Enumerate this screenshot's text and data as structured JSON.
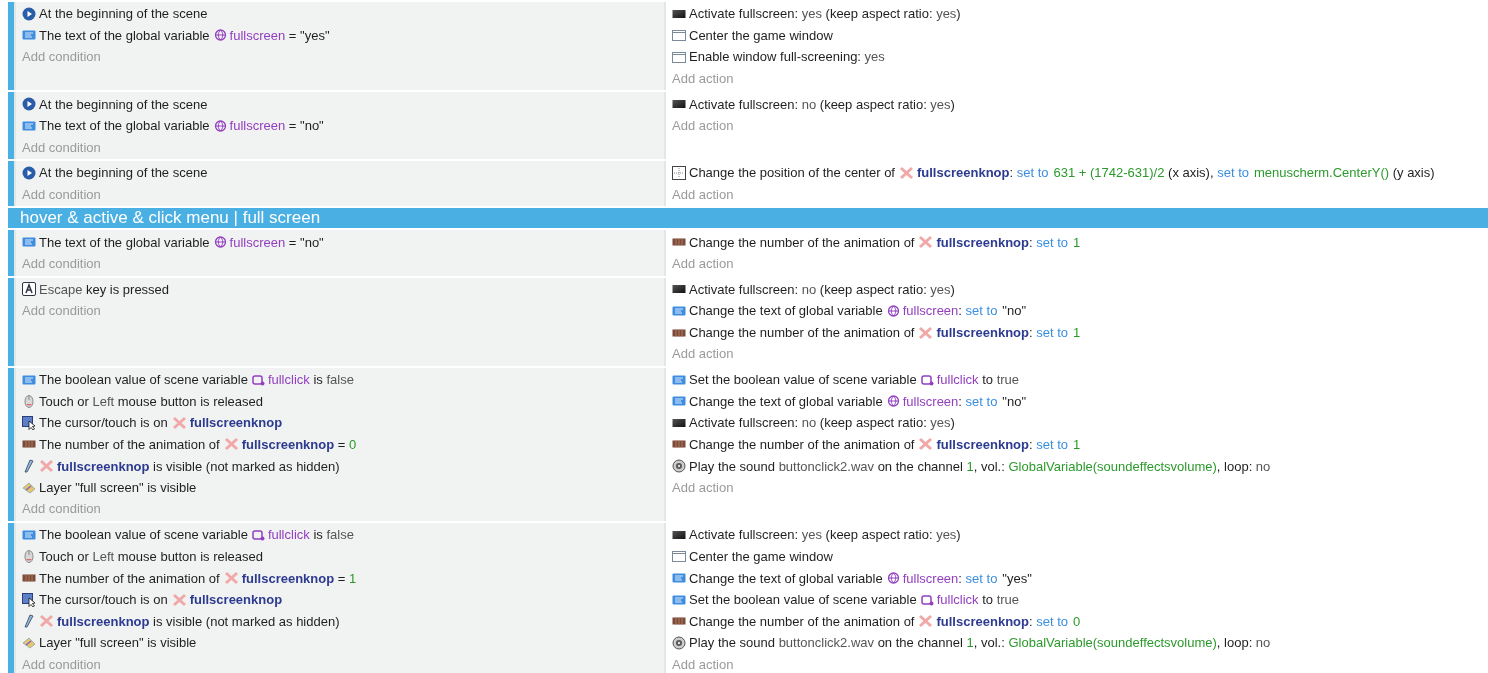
{
  "events": [
    {
      "kind": "event",
      "conditions": [
        {
          "kind": "start",
          "parts": [
            {
              "kind": "t",
              "text": "At the beginning of the scene"
            }
          ]
        },
        {
          "kind": "var",
          "parts": [
            {
              "kind": "t",
              "text": "The text of the global variable"
            },
            {
              "kind": "gv",
              "text": "fullscreen"
            },
            {
              "kind": "t",
              "text": " = "
            },
            {
              "kind": "t",
              "text": "\"yes\""
            }
          ]
        }
      ],
      "add_condition": "Add condition",
      "actions": [
        {
          "kind": "fullscreen",
          "parts": [
            {
              "kind": "t",
              "text": "Activate fullscreen: "
            },
            {
              "kind": "p",
              "text": "yes"
            },
            {
              "kind": "t",
              "text": " (keep aspect ratio: "
            },
            {
              "kind": "p",
              "text": "yes"
            },
            {
              "kind": "t",
              "text": ")"
            }
          ]
        },
        {
          "kind": "window",
          "parts": [
            {
              "kind": "t",
              "text": "Center the game window"
            }
          ]
        },
        {
          "kind": "window",
          "parts": [
            {
              "kind": "t",
              "text": "Enable window full-screening: "
            },
            {
              "kind": "p",
              "text": "yes"
            }
          ]
        }
      ],
      "add_action": "Add action"
    },
    {
      "kind": "event",
      "conditions": [
        {
          "kind": "start",
          "parts": [
            {
              "kind": "t",
              "text": "At the beginning of the scene"
            }
          ]
        },
        {
          "kind": "var",
          "parts": [
            {
              "kind": "t",
              "text": "The text of the global variable"
            },
            {
              "kind": "gv",
              "text": "fullscreen"
            },
            {
              "kind": "t",
              "text": " = "
            },
            {
              "kind": "t",
              "text": "\"no\""
            }
          ]
        }
      ],
      "add_condition": "Add condition",
      "actions": [
        {
          "kind": "fullscreen",
          "parts": [
            {
              "kind": "t",
              "text": "Activate fullscreen: "
            },
            {
              "kind": "p",
              "text": "no"
            },
            {
              "kind": "t",
              "text": " (keep aspect ratio: "
            },
            {
              "kind": "p",
              "text": "yes"
            },
            {
              "kind": "t",
              "text": ")"
            }
          ]
        }
      ],
      "add_action": "Add action"
    },
    {
      "kind": "event",
      "conditions": [
        {
          "kind": "start",
          "parts": [
            {
              "kind": "t",
              "text": "At the beginning of the scene"
            }
          ]
        }
      ],
      "add_condition": "Add condition",
      "actions": [
        {
          "kind": "position",
          "parts": [
            {
              "kind": "t",
              "text": "Change the position of the center of"
            },
            {
              "kind": "obj",
              "text": "fullscreenknop"
            },
            {
              "kind": "t",
              "text": ": "
            },
            {
              "kind": "op",
              "text": "set to"
            },
            {
              "kind": "num",
              "text": "631 + (1742-631)/2"
            },
            {
              "kind": "t",
              "text": " (x axis), "
            },
            {
              "kind": "op",
              "text": "set to"
            },
            {
              "kind": "num",
              "text": "menuscherm.CenterY()"
            },
            {
              "kind": "t",
              "text": " (y axis)"
            }
          ]
        }
      ],
      "add_action": "Add action"
    },
    {
      "kind": "group",
      "title": "hover & active & click menu | full screen"
    },
    {
      "kind": "event",
      "conditions": [
        {
          "kind": "var",
          "parts": [
            {
              "kind": "t",
              "text": "The text of the global variable"
            },
            {
              "kind": "gv",
              "text": "fullscreen"
            },
            {
              "kind": "t",
              "text": " = "
            },
            {
              "kind": "t",
              "text": "\"no\""
            }
          ]
        }
      ],
      "add_condition": "Add condition",
      "actions": [
        {
          "kind": "anim",
          "parts": [
            {
              "kind": "t",
              "text": "Change the number of the animation of"
            },
            {
              "kind": "obj",
              "text": "fullscreenknop"
            },
            {
              "kind": "t",
              "text": ": "
            },
            {
              "kind": "op",
              "text": "set to"
            },
            {
              "kind": "num",
              "text": "1"
            }
          ]
        }
      ],
      "add_action": "Add action"
    },
    {
      "kind": "event",
      "conditions": [
        {
          "kind": "key",
          "parts": [
            {
              "kind": "p",
              "text": "Escape"
            },
            {
              "kind": "t",
              "text": " key is pressed"
            }
          ]
        }
      ],
      "add_condition": "Add condition",
      "actions": [
        {
          "kind": "fullscreen",
          "parts": [
            {
              "kind": "t",
              "text": "Activate fullscreen: "
            },
            {
              "kind": "p",
              "text": "no"
            },
            {
              "kind": "t",
              "text": " (keep aspect ratio: "
            },
            {
              "kind": "p",
              "text": "yes"
            },
            {
              "kind": "t",
              "text": ")"
            }
          ]
        },
        {
          "kind": "var",
          "parts": [
            {
              "kind": "t",
              "text": "Change the text of global variable"
            },
            {
              "kind": "gv",
              "text": "fullscreen"
            },
            {
              "kind": "t",
              "text": ": "
            },
            {
              "kind": "op",
              "text": "set to"
            },
            {
              "kind": "t",
              "text": "\"no\""
            }
          ]
        },
        {
          "kind": "anim",
          "parts": [
            {
              "kind": "t",
              "text": "Change the number of the animation of"
            },
            {
              "kind": "obj",
              "text": "fullscreenknop"
            },
            {
              "kind": "t",
              "text": ": "
            },
            {
              "kind": "op",
              "text": "set to"
            },
            {
              "kind": "num",
              "text": "1"
            }
          ]
        }
      ],
      "add_action": "Add action"
    },
    {
      "kind": "event",
      "conditions": [
        {
          "kind": "var",
          "parts": [
            {
              "kind": "t",
              "text": "The boolean value of scene variable"
            },
            {
              "kind": "sv",
              "text": "fullclick"
            },
            {
              "kind": "t",
              "text": " is "
            },
            {
              "kind": "p",
              "text": "false"
            }
          ]
        },
        {
          "kind": "mouse",
          "parts": [
            {
              "kind": "t",
              "text": "Touch or "
            },
            {
              "kind": "p",
              "text": "Left"
            },
            {
              "kind": "t",
              "text": " mouse button is released"
            }
          ]
        },
        {
          "kind": "cursor",
          "parts": [
            {
              "kind": "t",
              "text": "The cursor/touch is on"
            },
            {
              "kind": "obj",
              "text": "fullscreenknop"
            }
          ]
        },
        {
          "kind": "anim",
          "parts": [
            {
              "kind": "t",
              "text": "The number of the animation of"
            },
            {
              "kind": "obj",
              "text": "fullscreenknop"
            },
            {
              "kind": "t",
              "text": " = "
            },
            {
              "kind": "num",
              "text": "0"
            }
          ]
        },
        {
          "kind": "visible",
          "parts": [
            {
              "kind": "obj",
              "text": "fullscreenknop"
            },
            {
              "kind": "t",
              "text": " is visible (not marked as hidden)"
            }
          ]
        },
        {
          "kind": "layer",
          "parts": [
            {
              "kind": "t",
              "text": "Layer \"full screen\" is visible"
            }
          ]
        }
      ],
      "add_condition": "Add condition",
      "actions": [
        {
          "kind": "var",
          "parts": [
            {
              "kind": "t",
              "text": "Set the boolean value of scene variable"
            },
            {
              "kind": "sv",
              "text": "fullclick"
            },
            {
              "kind": "t",
              "text": " to "
            },
            {
              "kind": "p",
              "text": "true"
            }
          ]
        },
        {
          "kind": "var",
          "parts": [
            {
              "kind": "t",
              "text": "Change the text of global variable"
            },
            {
              "kind": "gv",
              "text": "fullscreen"
            },
            {
              "kind": "t",
              "text": ": "
            },
            {
              "kind": "op",
              "text": "set to"
            },
            {
              "kind": "t",
              "text": "\"no\""
            }
          ]
        },
        {
          "kind": "fullscreen",
          "parts": [
            {
              "kind": "t",
              "text": "Activate fullscreen: "
            },
            {
              "kind": "p",
              "text": "no"
            },
            {
              "kind": "t",
              "text": " (keep aspect ratio: "
            },
            {
              "kind": "p",
              "text": "yes"
            },
            {
              "kind": "t",
              "text": ")"
            }
          ]
        },
        {
          "kind": "anim",
          "parts": [
            {
              "kind": "t",
              "text": "Change the number of the animation of"
            },
            {
              "kind": "obj",
              "text": "fullscreenknop"
            },
            {
              "kind": "t",
              "text": ": "
            },
            {
              "kind": "op",
              "text": "set to"
            },
            {
              "kind": "num",
              "text": "1"
            }
          ]
        },
        {
          "kind": "sound",
          "parts": [
            {
              "kind": "t",
              "text": "Play the sound "
            },
            {
              "kind": "p",
              "text": "buttonclick2.wav"
            },
            {
              "kind": "t",
              "text": " on the channel "
            },
            {
              "kind": "num",
              "text": "1"
            },
            {
              "kind": "t",
              "text": ", vol.: "
            },
            {
              "kind": "num",
              "text": "GlobalVariable(soundeffectsvolume)"
            },
            {
              "kind": "t",
              "text": ", loop: "
            },
            {
              "kind": "p",
              "text": "no"
            }
          ]
        }
      ],
      "add_action": "Add action"
    },
    {
      "kind": "event",
      "conditions": [
        {
          "kind": "var",
          "parts": [
            {
              "kind": "t",
              "text": "The boolean value of scene variable"
            },
            {
              "kind": "sv",
              "text": "fullclick"
            },
            {
              "kind": "t",
              "text": " is "
            },
            {
              "kind": "p",
              "text": "false"
            }
          ]
        },
        {
          "kind": "mouse",
          "parts": [
            {
              "kind": "t",
              "text": "Touch or "
            },
            {
              "kind": "p",
              "text": "Left"
            },
            {
              "kind": "t",
              "text": " mouse button is released"
            }
          ]
        },
        {
          "kind": "anim",
          "parts": [
            {
              "kind": "t",
              "text": "The number of the animation of"
            },
            {
              "kind": "obj",
              "text": "fullscreenknop"
            },
            {
              "kind": "t",
              "text": " = "
            },
            {
              "kind": "num",
              "text": "1"
            }
          ]
        },
        {
          "kind": "cursor",
          "parts": [
            {
              "kind": "t",
              "text": "The cursor/touch is on"
            },
            {
              "kind": "obj",
              "text": "fullscreenknop"
            }
          ]
        },
        {
          "kind": "visible",
          "parts": [
            {
              "kind": "obj",
              "text": "fullscreenknop"
            },
            {
              "kind": "t",
              "text": " is visible (not marked as hidden)"
            }
          ]
        },
        {
          "kind": "layer",
          "parts": [
            {
              "kind": "t",
              "text": "Layer \"full screen\" is visible"
            }
          ]
        }
      ],
      "add_condition": "Add condition",
      "actions": [
        {
          "kind": "fullscreen",
          "parts": [
            {
              "kind": "t",
              "text": "Activate fullscreen: "
            },
            {
              "kind": "p",
              "text": "yes"
            },
            {
              "kind": "t",
              "text": " (keep aspect ratio: "
            },
            {
              "kind": "p",
              "text": "yes"
            },
            {
              "kind": "t",
              "text": ")"
            }
          ]
        },
        {
          "kind": "window",
          "parts": [
            {
              "kind": "t",
              "text": "Center the game window"
            }
          ]
        },
        {
          "kind": "var",
          "parts": [
            {
              "kind": "t",
              "text": "Change the text of global variable"
            },
            {
              "kind": "gv",
              "text": "fullscreen"
            },
            {
              "kind": "t",
              "text": ": "
            },
            {
              "kind": "op",
              "text": "set to"
            },
            {
              "kind": "t",
              "text": "\"yes\""
            }
          ]
        },
        {
          "kind": "var",
          "parts": [
            {
              "kind": "t",
              "text": "Set the boolean value of scene variable"
            },
            {
              "kind": "sv",
              "text": "fullclick"
            },
            {
              "kind": "t",
              "text": " to "
            },
            {
              "kind": "p",
              "text": "true"
            }
          ]
        },
        {
          "kind": "anim",
          "parts": [
            {
              "kind": "t",
              "text": "Change the number of the animation of"
            },
            {
              "kind": "obj",
              "text": "fullscreenknop"
            },
            {
              "kind": "t",
              "text": ": "
            },
            {
              "kind": "op",
              "text": "set to"
            },
            {
              "kind": "num",
              "text": "0"
            }
          ]
        },
        {
          "kind": "sound",
          "parts": [
            {
              "kind": "t",
              "text": "Play the sound "
            },
            {
              "kind": "p",
              "text": "buttonclick2.wav"
            },
            {
              "kind": "t",
              "text": " on the channel "
            },
            {
              "kind": "num",
              "text": "1"
            },
            {
              "kind": "t",
              "text": ", vol.: "
            },
            {
              "kind": "num",
              "text": "GlobalVariable(soundeffectsvolume)"
            },
            {
              "kind": "t",
              "text": ", loop: "
            },
            {
              "kind": "p",
              "text": "no"
            }
          ]
        }
      ],
      "add_action": "Add action"
    }
  ]
}
